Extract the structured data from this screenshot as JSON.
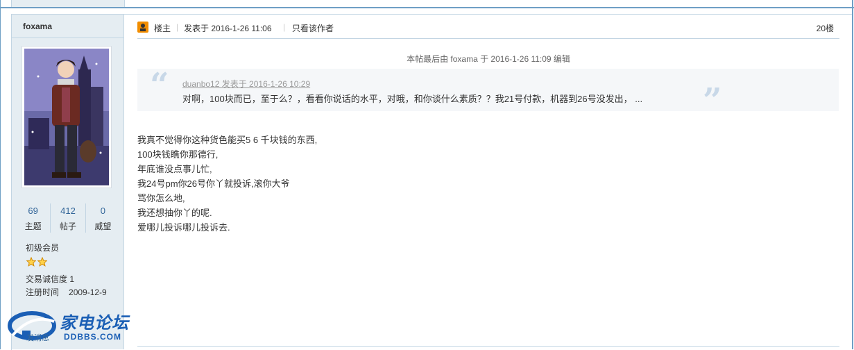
{
  "user": {
    "name": "foxama",
    "stats": [
      {
        "value": "69",
        "label": "主题"
      },
      {
        "value": "412",
        "label": "帖子"
      },
      {
        "value": "0",
        "label": "威望"
      }
    ],
    "rank": "初级会员",
    "stars": 2,
    "credit": "交易诚信度 1",
    "reg_label": "注册时间",
    "reg_date": "2009-12-9"
  },
  "post": {
    "owner_label": "楼主",
    "posted_at": "发表于 2016-1-26 11:06",
    "only_author": "只看该作者",
    "floor": "20楼",
    "edit_note": "本帖最后由 foxama 于 2016-1-26 11:09 编辑",
    "quote": {
      "author_line": "duanbo12 发表于 2016-1-26 10:29",
      "text": "对啊，100块而已，至于么？，看看你说话的水平，对哦，和你谈什么素质？？我21号付款，机器到26号没发出， ..."
    },
    "lines": [
      "我真不觉得你这种货色能买5 6 千块钱的东西,",
      "100块钱瞧你那德行,",
      "年底谁没点事儿忙,",
      "我24号pm你26号你丫就投诉,滚你大爷",
      "骂你怎么地,",
      "我还想抽你丫的呢.",
      "爱哪儿投诉哪儿投诉去."
    ]
  },
  "logo": {
    "brand": "家电论坛",
    "domain": "DDBBS.COM",
    "message_link": "发消息"
  },
  "colors": {
    "sidebar_bg": "#e5edf2",
    "border": "#c2d5e3",
    "accent": "#336699",
    "brand": "#1b5fb5",
    "owner_badge": "#f18d00"
  }
}
